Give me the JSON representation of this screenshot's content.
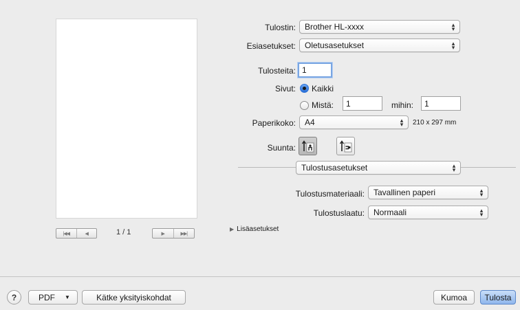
{
  "preview": {
    "page_indicator": "1 / 1",
    "first_label": "|◀◀",
    "prev_label": "◀",
    "next_label": "▶",
    "last_label": "▶▶|"
  },
  "printer": {
    "label": "Tulostin:",
    "value": "Brother HL-xxxx"
  },
  "presets": {
    "label": "Esiasetukset:",
    "value": "Oletusasetukset"
  },
  "copies": {
    "label": "Tulosteita:",
    "value": "1"
  },
  "pages": {
    "label": "Sivut:",
    "all_label": "Kaikki",
    "from_label": "Mistä:",
    "from_value": "1",
    "to_label": "mihin:",
    "to_value": "1",
    "selected": "all"
  },
  "paper_size": {
    "label": "Paperikoko:",
    "value": "A4",
    "dimensions": "210 x 297 mm"
  },
  "orientation": {
    "label": "Suunta:",
    "selected": "portrait"
  },
  "section": {
    "value": "Tulostusasetukset"
  },
  "media": {
    "label": "Tulostusmateriaali:",
    "value": "Tavallinen paperi"
  },
  "quality": {
    "label": "Tulostuslaatu:",
    "value": "Normaali"
  },
  "advanced": {
    "label": "Lisäasetukset"
  },
  "footer": {
    "help_label": "?",
    "pdf_label": "PDF",
    "hide_details_label": "Kätke yksityiskohdat",
    "cancel_label": "Kumoa",
    "print_label": "Tulosta"
  },
  "colors": {
    "accent": "#2a6fd6",
    "default_button": "#8fb6ec",
    "background": "#ececec"
  }
}
